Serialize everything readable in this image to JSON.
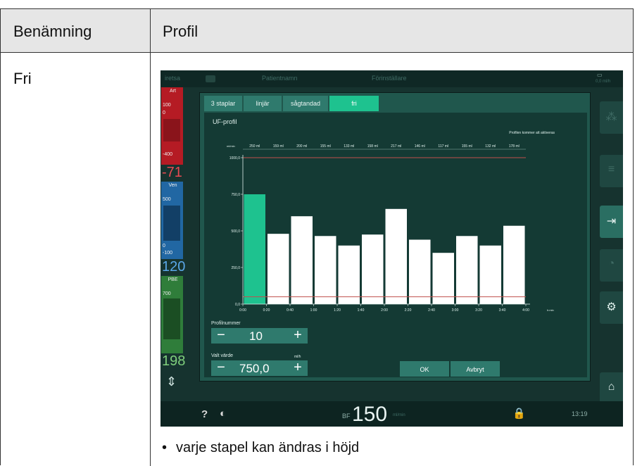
{
  "doc": {
    "col1_header": "Benämning",
    "col2_header": "Profil",
    "row_name": "Fri",
    "bullet": "varje stapel kan ändras i höjd"
  },
  "screen": {
    "topbar": {
      "left": "iretsa",
      "patient": "Patientnamn",
      "program": "Förinställare",
      "right": "0,0 ml/h"
    },
    "left_panel": {
      "art_label": "Art",
      "art_upper": "100",
      "art_zero": "0",
      "art_lower": "-400",
      "art_value": "-71",
      "ven_label": "Ven",
      "ven_upper": "500",
      "ven_zero": "0",
      "ven_lower": "-100",
      "ven_value": "120",
      "pbe_label": "PBE",
      "pbe_upper": "700",
      "pbe_value": "198"
    },
    "tabs": [
      {
        "label": "3 staplar",
        "active": false
      },
      {
        "label": "linjär",
        "active": false
      },
      {
        "label": "sågtandad",
        "active": false
      },
      {
        "label": "fri",
        "active": true
      }
    ],
    "uf_title": "UF-profil",
    "note": "Profilen kommer att aktiveras",
    "profile_number_label": "Profilnummer",
    "profile_number": "10",
    "selected_value_label": "Valt värde",
    "selected_value_unit": "ml/h",
    "selected_value": "750,0",
    "minus": "−",
    "plus": "+",
    "ok_label": "OK",
    "cancel_label": "Avbryt",
    "bottombar": {
      "help": "?",
      "bf_label": "BF",
      "bf_value": "150",
      "bf_unit": "ml/min",
      "time": "13:19"
    },
    "colors": {
      "bar": "#ffffff",
      "bar_selected": "#1ec28f",
      "limit_line": "#c0504d"
    }
  },
  "chart_data": {
    "type": "bar",
    "ylabel": "ml/min",
    "xlabel": "h:min",
    "ylim": [
      0,
      1000
    ],
    "yticks": [
      "0,0",
      "250,0",
      "500,0",
      "750,0",
      "1000,0"
    ],
    "xticks": [
      "0:00",
      "0:20",
      "0:40",
      "1:00",
      "1:20",
      "1:40",
      "2:00",
      "2:20",
      "2:40",
      "3:00",
      "3:20",
      "3:40",
      "4:00"
    ],
    "top_labels": [
      "250 ml",
      "159 ml",
      "200 ml",
      "155 ml",
      "133 ml",
      "158 ml",
      "217 ml",
      "146 ml",
      "117 ml",
      "155 ml",
      "132 ml",
      "178 ml"
    ],
    "values": [
      750,
      480,
      600,
      465,
      400,
      475,
      650,
      440,
      350,
      465,
      400,
      535
    ],
    "selected_index": 0,
    "upper_limit": 1000,
    "lower_limit": 50
  }
}
